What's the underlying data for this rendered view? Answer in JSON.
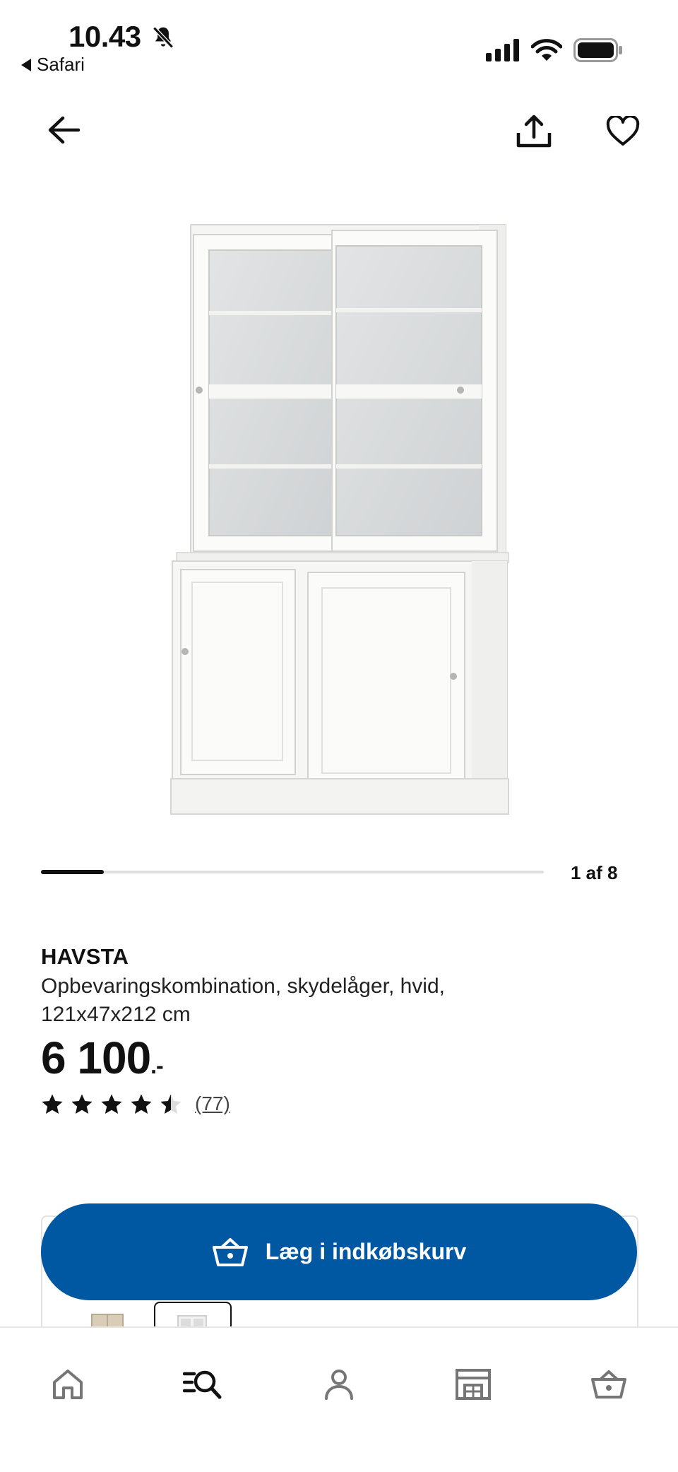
{
  "status_bar": {
    "time": "10.43",
    "back_app": "Safari"
  },
  "top_nav": {
    "back_icon": "arrow-left-icon",
    "share_icon": "share-icon",
    "favorite_icon": "heart-icon"
  },
  "gallery": {
    "counter": "1 af 8",
    "current": 1,
    "total": 8,
    "progress_fraction": 0.125
  },
  "product": {
    "brand": "HAVSTA",
    "description": "Opbevaringskombination, skydelåger, hvid, 121x47x212 cm",
    "price": "6 100",
    "price_suffix": ".-",
    "rating_value": 4.5,
    "rating_max": 5,
    "review_count": "(77)"
  },
  "actions": {
    "add_to_cart_label": "Læg i indkøbskurv",
    "cart_icon": "basket-icon"
  },
  "variants": [
    {
      "color_name": "beige"
    },
    {
      "color_name": "white",
      "selected": true
    }
  ],
  "tabbar": {
    "items": [
      {
        "name": "home",
        "icon": "home-icon"
      },
      {
        "name": "search",
        "icon": "search-icon"
      },
      {
        "name": "profile",
        "icon": "user-icon"
      },
      {
        "name": "store",
        "icon": "store-icon"
      },
      {
        "name": "cart",
        "icon": "basket-icon"
      }
    ]
  },
  "colors": {
    "accent": "#0058a3",
    "text": "#111111"
  }
}
